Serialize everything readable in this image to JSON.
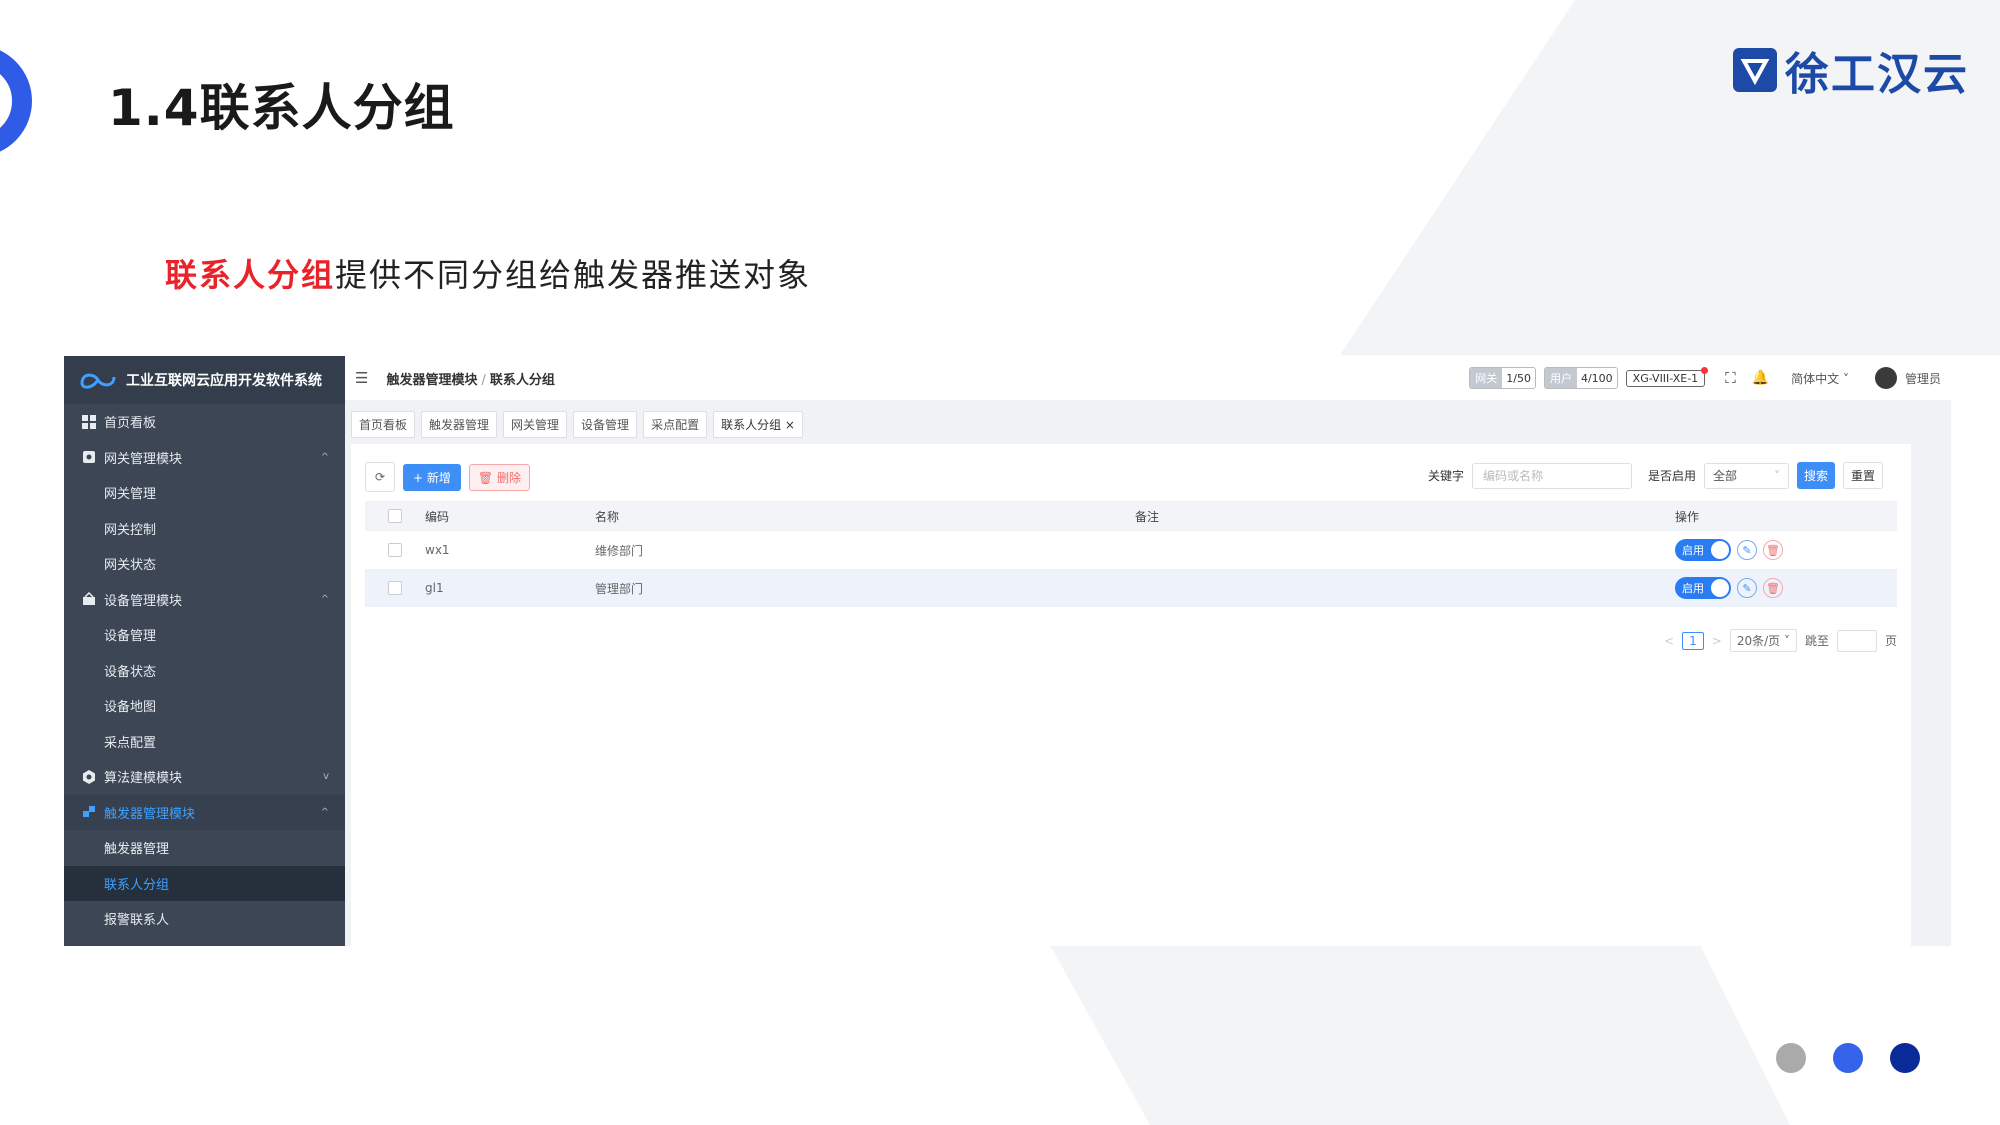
{
  "slide": {
    "title": "1.4联系人分组",
    "brand": "徐工汉云",
    "description_highlight": "联系人分组",
    "description_rest": "提供不同分组给触发器推送对象",
    "dot_colors": [
      "#aaaaaa",
      "#3563e9",
      "#0a2a9a"
    ]
  },
  "sidebar": {
    "system_name": "工业互联网云应用开发软件系统",
    "items": [
      {
        "label": "首页看板",
        "icon": "dashboard-icon"
      },
      {
        "label": "网关管理模块",
        "icon": "gateway-icon",
        "caret": "^"
      },
      {
        "label": "网关管理"
      },
      {
        "label": "网关控制"
      },
      {
        "label": "网关状态"
      },
      {
        "label": "设备管理模块",
        "icon": "device-icon",
        "caret": "^"
      },
      {
        "label": "设备管理"
      },
      {
        "label": "设备状态"
      },
      {
        "label": "设备地图"
      },
      {
        "label": "采点配置"
      },
      {
        "label": "算法建模模块",
        "icon": "algorithm-icon",
        "caret": "v"
      },
      {
        "label": "触发器管理模块",
        "icon": "trigger-icon",
        "caret": "^"
      },
      {
        "label": "触发器管理"
      },
      {
        "label": "联系人分组"
      },
      {
        "label": "报警联系人"
      }
    ]
  },
  "topbar": {
    "breadcrumb_parent": "触发器管理模块",
    "breadcrumb_current": "联系人分组",
    "gateway_key": "网关",
    "gateway_val": "1/50",
    "user_key": "用户",
    "user_val": "4/100",
    "device_tag": "XG-VIII-XE-1",
    "language": "简体中文",
    "username": "管理员"
  },
  "tabs": [
    "首页看板",
    "触发器管理",
    "网关管理",
    "设备管理",
    "采点配置",
    "联系人分组"
  ],
  "toolbar": {
    "add_label": "新增",
    "delete_label": "删除",
    "keyword_label": "关键字",
    "keyword_placeholder": "编码或名称",
    "enabled_label": "是否启用",
    "enabled_value": "全部",
    "search_label": "搜索",
    "reset_label": "重置"
  },
  "table": {
    "headers": {
      "code": "编码",
      "name": "名称",
      "note": "备注",
      "op": "操作"
    },
    "rows": [
      {
        "code": "wx1",
        "name": "维修部门",
        "note": "",
        "status": "启用"
      },
      {
        "code": "gl1",
        "name": "管理部门",
        "note": "",
        "status": "启用"
      }
    ]
  },
  "pagination": {
    "prev": "<",
    "page": "1",
    "next": ">",
    "page_size": "20条/页",
    "goto_label": "跳至",
    "page_suffix": "页"
  }
}
